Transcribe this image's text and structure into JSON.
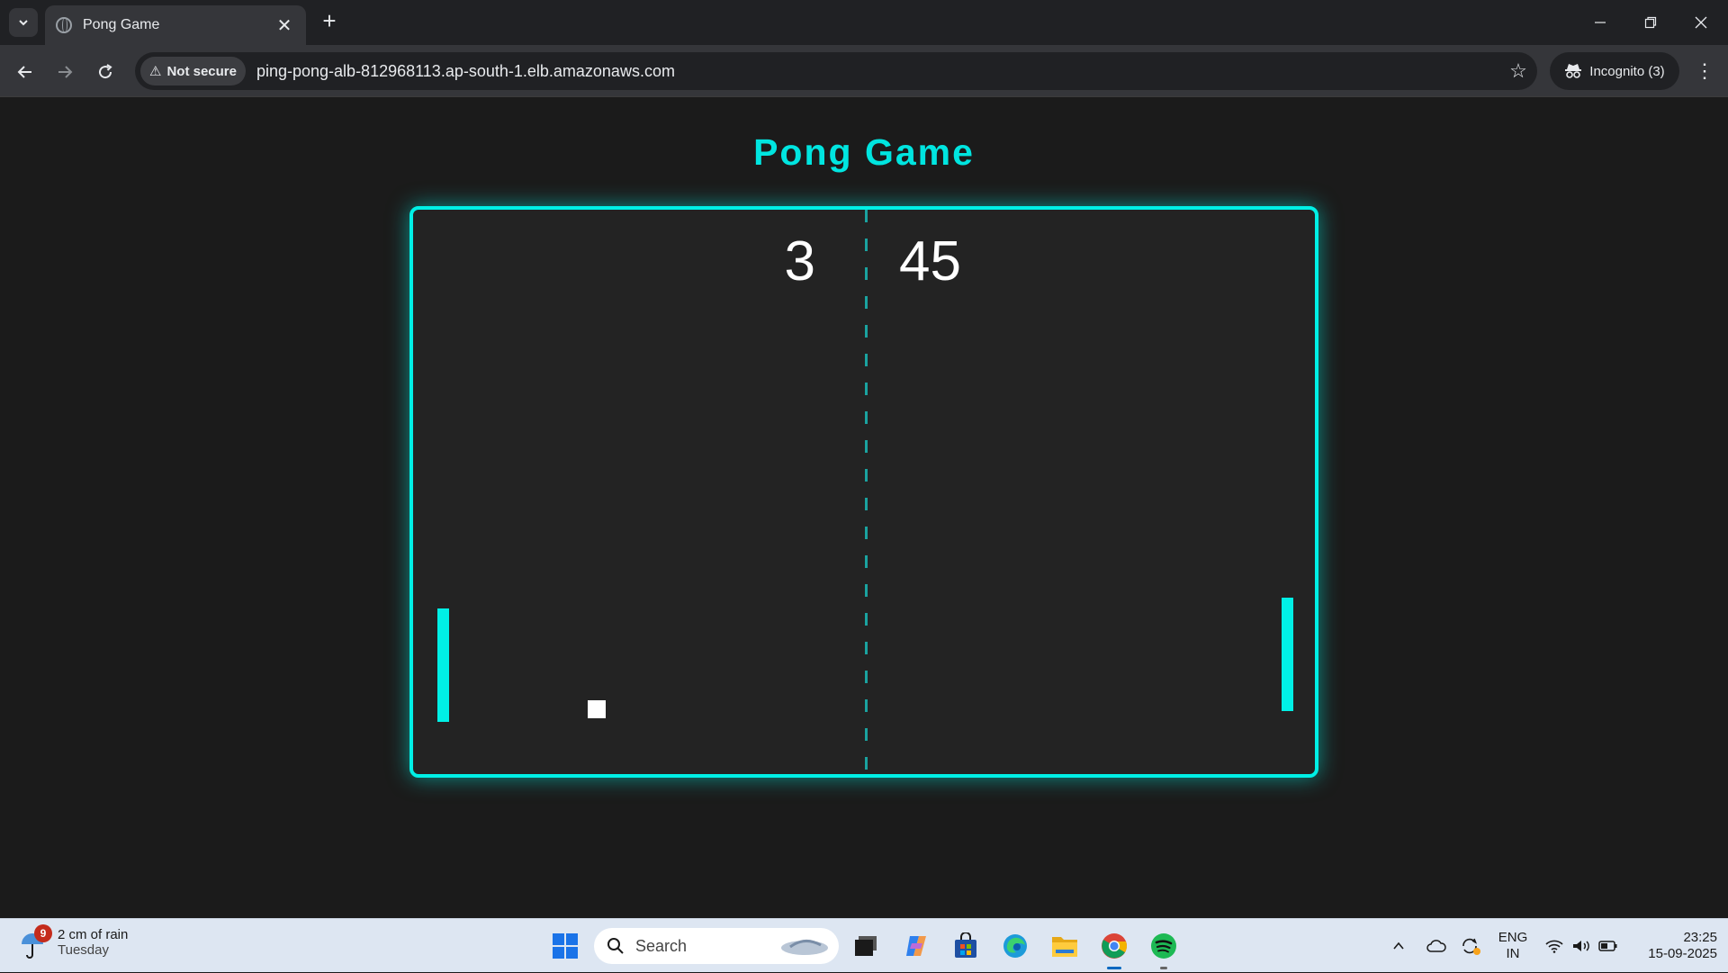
{
  "browser": {
    "tab_title": "Pong Game",
    "security_label": "Not secure",
    "url": "ping-pong-alb-812968113.ap-south-1.elb.amazonaws.com",
    "incognito_label": "Incognito (3)"
  },
  "game": {
    "title": "Pong Game",
    "score_left": "3",
    "score_right": "45",
    "accent_color": "#00f0e6"
  },
  "taskbar": {
    "weather_badge": "9",
    "weather_line1": "2 cm of rain",
    "weather_line2": "Tuesday",
    "search_placeholder": "Search",
    "lang_line1": "ENG",
    "lang_line2": "IN",
    "time": "23:25",
    "date": "15-09-2025",
    "apps": [
      "start-icon",
      "task-view-icon",
      "copilot-icon",
      "store-icon",
      "edge-icon",
      "file-explorer-icon",
      "chrome-icon",
      "spotify-icon"
    ]
  }
}
